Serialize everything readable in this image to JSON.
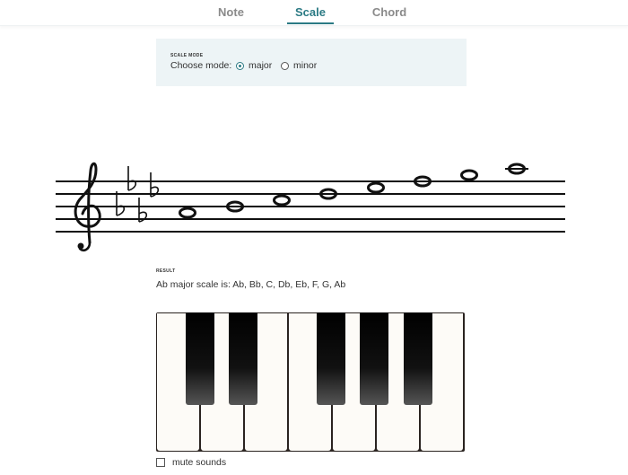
{
  "tabs": [
    {
      "label": "Note",
      "active": false
    },
    {
      "label": "Scale",
      "active": true
    },
    {
      "label": "Chord",
      "active": false
    }
  ],
  "mode_panel": {
    "caption": "SCALE MODE",
    "label": "Choose mode:",
    "options": [
      {
        "label": "major",
        "selected": true
      },
      {
        "label": "minor",
        "selected": false
      }
    ]
  },
  "staff": {
    "clef": "treble-clef",
    "key_signature": [
      "Bb",
      "Eb",
      "Ab",
      "Db"
    ],
    "notes": [
      "Ab4",
      "Bb4",
      "C5",
      "Db5",
      "Eb5",
      "F5",
      "G5",
      "Ab5"
    ]
  },
  "result": {
    "caption": "RESULT",
    "text": "Ab major scale is: Ab, Bb, C, Db, Eb, F, G, Ab"
  },
  "piano": {
    "white_keys": [
      "C",
      "D",
      "E",
      "F",
      "G",
      "A",
      "B"
    ],
    "black_keys": [
      "C#",
      "D#",
      "F#",
      "G#",
      "A#"
    ]
  },
  "mute": {
    "label": "mute sounds",
    "checked": false
  },
  "colors": {
    "accent": "#2b7a84",
    "panel_bg": "#edf4f6"
  }
}
